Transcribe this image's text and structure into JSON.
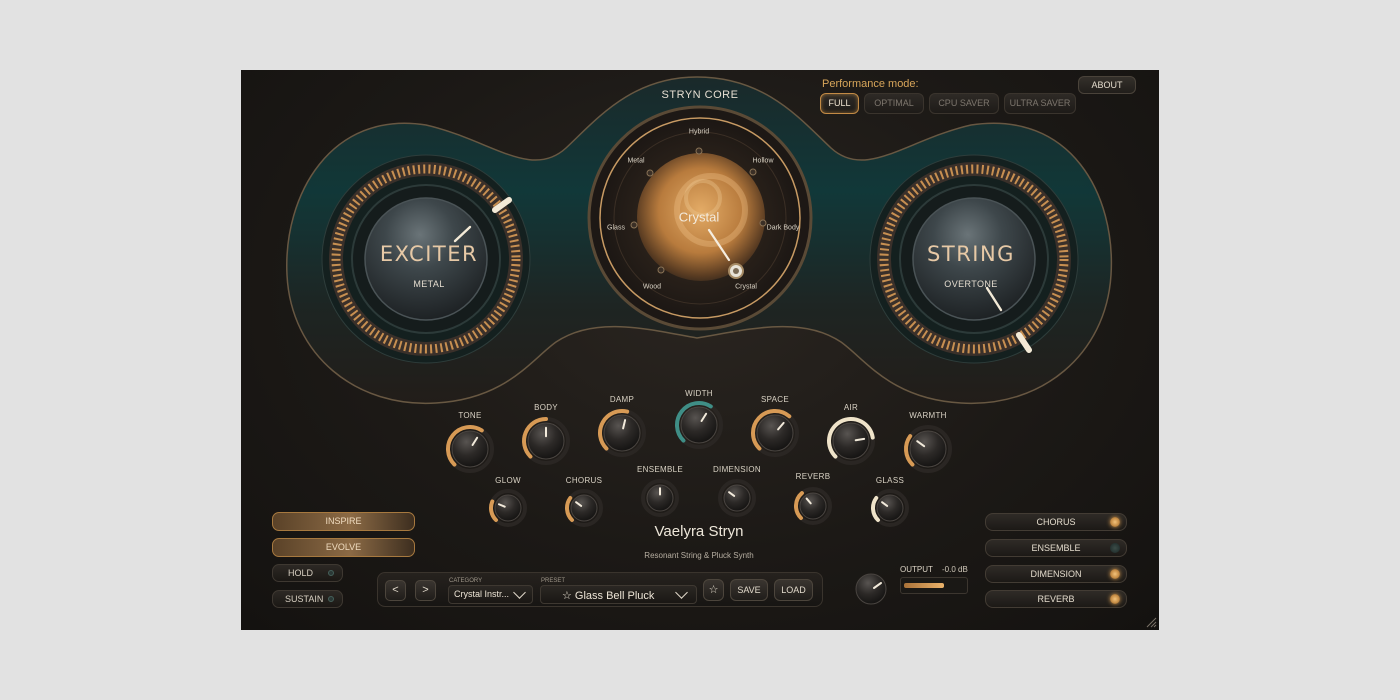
{
  "header": {
    "core_title": "STRYN CORE",
    "performance_label": "Performance mode:",
    "performance_modes": [
      "FULL",
      "OPTIMAL",
      "CPU SAVER",
      "ULTRA SAVER"
    ],
    "performance_selected": "FULL",
    "about_label": "ABOUT"
  },
  "exciter": {
    "name": "EXCITER",
    "value": "METAL",
    "level": 0.68
  },
  "string": {
    "name": "STRING",
    "value": "OVERTONE",
    "level": 0.86
  },
  "core": {
    "selected": "Crystal",
    "nodes": [
      "Hybrid",
      "Hollow",
      "Dark Body",
      "Crystal",
      "Wood",
      "Glass",
      "Metal"
    ]
  },
  "knobs_top": [
    {
      "label": "TONE",
      "value": 0.62,
      "ring": "amber"
    },
    {
      "label": "BODY",
      "value": 0.5,
      "ring": "amber"
    },
    {
      "label": "DAMP",
      "value": 0.55,
      "ring": "amber"
    },
    {
      "label": "WIDTH",
      "value": 0.62,
      "ring": "teal"
    },
    {
      "label": "SPACE",
      "value": 0.65,
      "ring": "amber"
    },
    {
      "label": "AIR",
      "value": 0.8,
      "ring": "cream"
    },
    {
      "label": "WARMTH",
      "value": 0.3,
      "ring": "amber"
    }
  ],
  "knobs_bottom": [
    {
      "label": "GLOW",
      "value": 0.25,
      "ring": "amber"
    },
    {
      "label": "CHORUS",
      "value": 0.3,
      "ring": "amber"
    },
    {
      "label": "ENSEMBLE",
      "value": 0.5,
      "ring": "none"
    },
    {
      "label": "DIMENSION",
      "value": 0.3,
      "ring": "none"
    },
    {
      "label": "REVERB",
      "value": 0.35,
      "ring": "amber"
    },
    {
      "label": "GLASS",
      "value": 0.3,
      "ring": "cream"
    }
  ],
  "left_buttons": {
    "inspire": "INSPIRE",
    "evolve": "EVOLVE",
    "hold": "HOLD",
    "sustain": "SUSTAIN"
  },
  "fx": [
    {
      "label": "CHORUS",
      "on": true
    },
    {
      "label": "ENSEMBLE",
      "on": false
    },
    {
      "label": "DIMENSION",
      "on": true
    },
    {
      "label": "REVERB",
      "on": true
    }
  ],
  "title": "Vaelyra Stryn",
  "subtitle": "Resonant String & Pluck Synth",
  "preset_bar": {
    "prev": "<",
    "next": ">",
    "category_label": "CATEGORY",
    "category_value": "Crystal Instr...",
    "preset_label": "PRESET",
    "preset_value": "☆ Glass Bell Pluck",
    "favorite": "☆",
    "save": "SAVE",
    "load": "LOAD"
  },
  "output": {
    "label": "OUTPUT",
    "value": "-0.0 dB",
    "level": 0.65
  },
  "colors": {
    "amber": "#d79a55",
    "teal": "#3f8e86",
    "cream": "#efe3c9",
    "panel_teal": "#113536"
  }
}
